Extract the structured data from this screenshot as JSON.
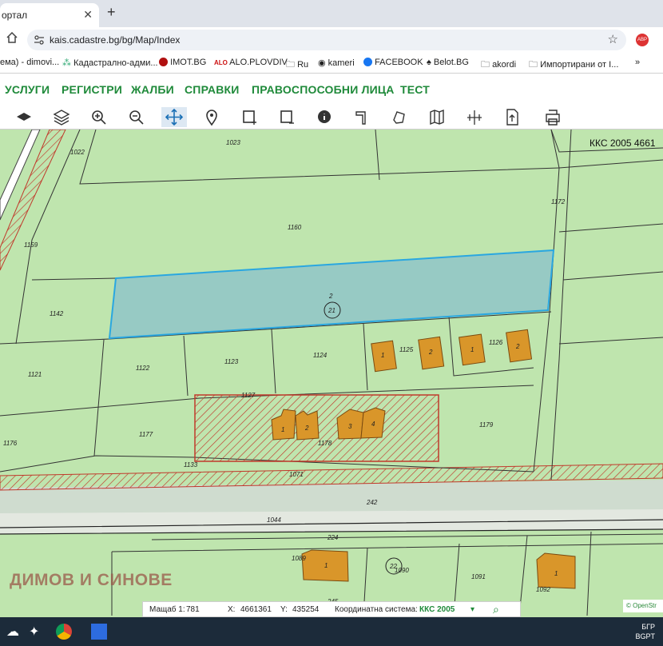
{
  "browser": {
    "tab_title": "ортал",
    "url": "kais.cadastre.bg/bg/Map/Index",
    "bookmarks": [
      "ема) - dimovi...",
      "Кадастрално-адми...",
      "IMOT.BG",
      "ALO.PLOVDIV",
      "Ru",
      "kameri",
      "FACEBOOK",
      "Belot.BG",
      "akordi",
      "Импортирани от I..."
    ],
    "ext_badge": "ABP"
  },
  "nav": [
    "УСЛУГИ",
    "РЕГИСТРИ",
    "ЖАЛБИ",
    "СПРАВКИ",
    "ПРАВОСПОСОБНИ ЛИЦА",
    "ТЕСТ"
  ],
  "toolbar_icons": [
    "layers-icon",
    "layers-stack-icon",
    "zoom-in-icon",
    "zoom-out-icon",
    "pan-icon",
    "marker-icon",
    "select-rect-icon",
    "clear-select-icon",
    "info-icon",
    "pen-icon",
    "measure-area-icon",
    "map-icon",
    "measure-line-icon",
    "export-icon",
    "print-icon"
  ],
  "map": {
    "crs_label": "ККС 2005 4661",
    "parcel_labels": [
      "1023",
      "1022",
      "1172",
      "1160",
      "1159",
      "1142",
      "2",
      "21",
      "1121",
      "1122",
      "1123",
      "1124",
      "1125",
      "1126",
      "1127",
      "1177",
      "1178",
      "1179",
      "1176",
      "1133",
      "1071",
      "242",
      "1044",
      "224",
      "1089",
      "1090",
      "1091",
      "1092",
      "22",
      "245"
    ],
    "building_numbers": [
      "1",
      "2",
      "1",
      "2",
      "1",
      "2",
      "3",
      "4",
      "1",
      "1"
    ],
    "watermark": "ДИМОВ И СИНОВЕ",
    "attribution": "© OpenStr"
  },
  "status": {
    "scale_label": "Мащаб 1:",
    "scale_value": "781",
    "x_label": "X:",
    "x_value": "4661361",
    "y_label": "Y:",
    "y_value": "435254",
    "crs_label": "Координатна система:",
    "crs_value": "ККС 2005"
  },
  "taskbar": {
    "lang": "БГР",
    "lang2": "BGPT"
  }
}
